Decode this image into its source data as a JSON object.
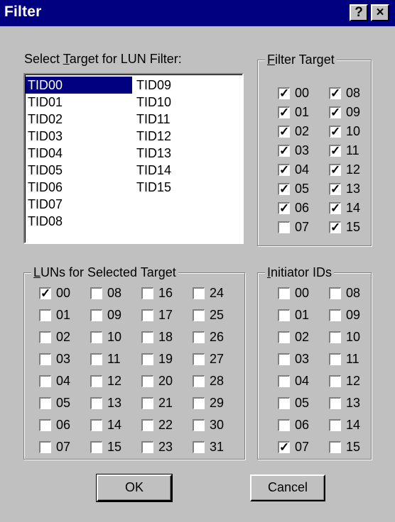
{
  "window": {
    "title": "Filter",
    "help_label": "?",
    "close_label": "×"
  },
  "select_target": {
    "label_pre": "Select ",
    "label_accel": "T",
    "label_post": "arget for LUN Filter:",
    "items": [
      "TID00",
      "TID01",
      "TID02",
      "TID03",
      "TID04",
      "TID05",
      "TID06",
      "TID07",
      "TID08",
      "TID09",
      "TID10",
      "TID11",
      "TID12",
      "TID13",
      "TID14",
      "TID15"
    ],
    "selected": "TID00"
  },
  "filter_target": {
    "legend_accel": "F",
    "legend_rest": "ilter Target",
    "items": [
      {
        "label": "00",
        "checked": true
      },
      {
        "label": "01",
        "checked": true
      },
      {
        "label": "02",
        "checked": true
      },
      {
        "label": "03",
        "checked": true
      },
      {
        "label": "04",
        "checked": true
      },
      {
        "label": "05",
        "checked": true
      },
      {
        "label": "06",
        "checked": true
      },
      {
        "label": "07",
        "checked": false
      },
      {
        "label": "08",
        "checked": true
      },
      {
        "label": "09",
        "checked": true
      },
      {
        "label": "10",
        "checked": true
      },
      {
        "label": "11",
        "checked": true
      },
      {
        "label": "12",
        "checked": true
      },
      {
        "label": "13",
        "checked": true
      },
      {
        "label": "14",
        "checked": true
      },
      {
        "label": "15",
        "checked": true
      }
    ]
  },
  "luns": {
    "legend_accel": "L",
    "legend_rest": "UNs for Selected Target",
    "items": [
      {
        "label": "00",
        "checked": true
      },
      {
        "label": "01",
        "checked": false
      },
      {
        "label": "02",
        "checked": false
      },
      {
        "label": "03",
        "checked": false
      },
      {
        "label": "04",
        "checked": false
      },
      {
        "label": "05",
        "checked": false
      },
      {
        "label": "06",
        "checked": false
      },
      {
        "label": "07",
        "checked": false
      },
      {
        "label": "08",
        "checked": false
      },
      {
        "label": "09",
        "checked": false
      },
      {
        "label": "10",
        "checked": false
      },
      {
        "label": "11",
        "checked": false
      },
      {
        "label": "12",
        "checked": false
      },
      {
        "label": "13",
        "checked": false
      },
      {
        "label": "14",
        "checked": false
      },
      {
        "label": "15",
        "checked": false
      },
      {
        "label": "16",
        "checked": false
      },
      {
        "label": "17",
        "checked": false
      },
      {
        "label": "18",
        "checked": false
      },
      {
        "label": "19",
        "checked": false
      },
      {
        "label": "20",
        "checked": false
      },
      {
        "label": "21",
        "checked": false
      },
      {
        "label": "22",
        "checked": false
      },
      {
        "label": "23",
        "checked": false
      },
      {
        "label": "24",
        "checked": false
      },
      {
        "label": "25",
        "checked": false
      },
      {
        "label": "26",
        "checked": false
      },
      {
        "label": "27",
        "checked": false
      },
      {
        "label": "28",
        "checked": false
      },
      {
        "label": "29",
        "checked": false
      },
      {
        "label": "30",
        "checked": false
      },
      {
        "label": "31",
        "checked": false
      }
    ]
  },
  "initiators": {
    "legend_accel": "I",
    "legend_rest": "nitiator IDs",
    "items": [
      {
        "label": "00",
        "checked": false
      },
      {
        "label": "01",
        "checked": false
      },
      {
        "label": "02",
        "checked": false
      },
      {
        "label": "03",
        "checked": false
      },
      {
        "label": "04",
        "checked": false
      },
      {
        "label": "05",
        "checked": false
      },
      {
        "label": "06",
        "checked": false
      },
      {
        "label": "07",
        "checked": true
      },
      {
        "label": "08",
        "checked": false
      },
      {
        "label": "09",
        "checked": false
      },
      {
        "label": "10",
        "checked": false
      },
      {
        "label": "11",
        "checked": false
      },
      {
        "label": "12",
        "checked": false
      },
      {
        "label": "13",
        "checked": false
      },
      {
        "label": "14",
        "checked": false
      },
      {
        "label": "15",
        "checked": false
      }
    ]
  },
  "buttons": {
    "ok": "OK",
    "cancel": "Cancel"
  }
}
